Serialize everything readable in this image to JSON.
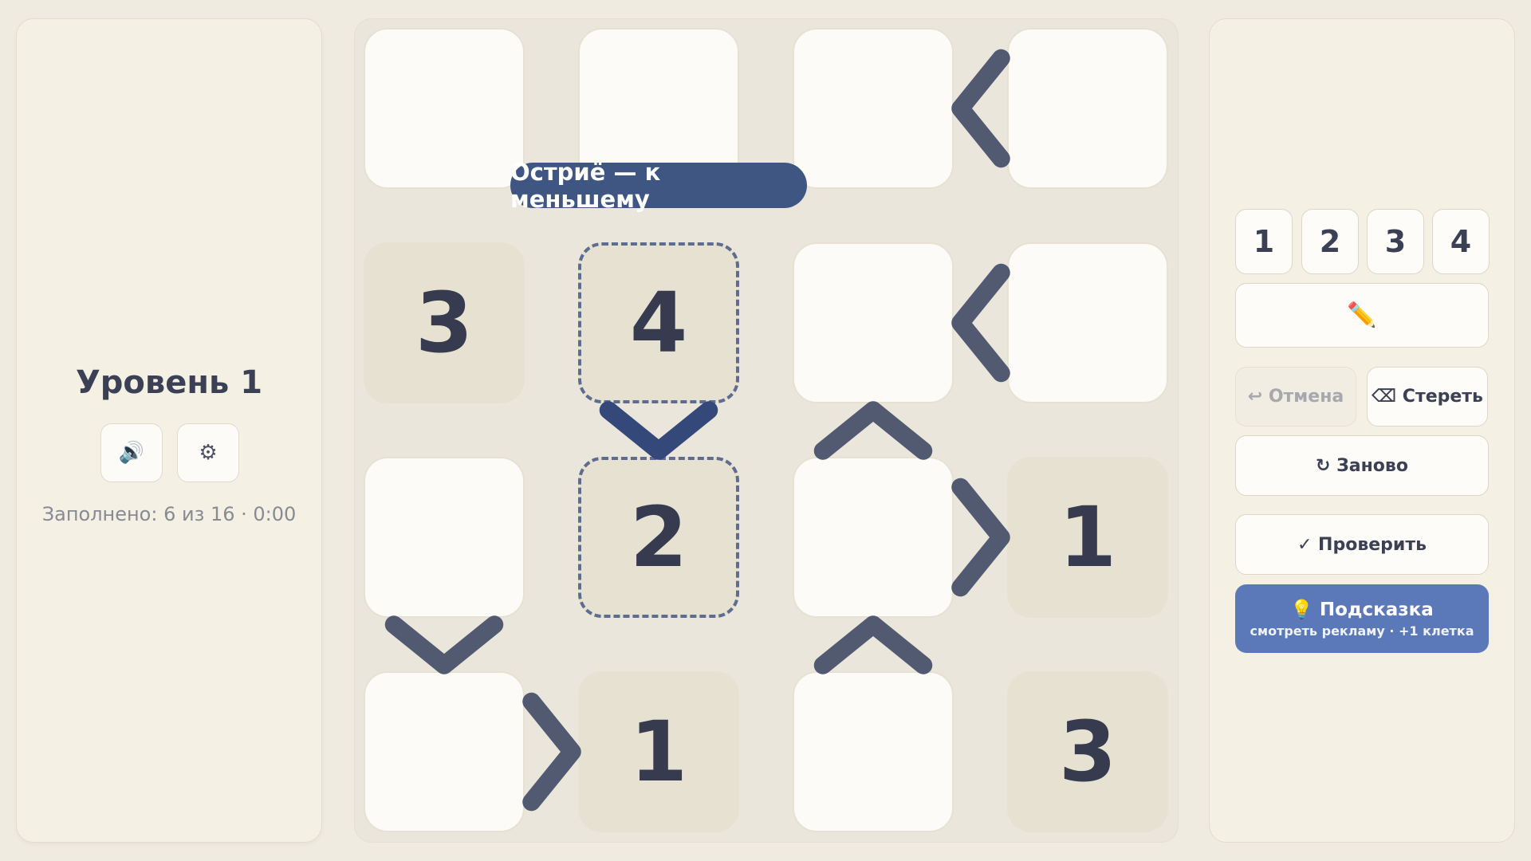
{
  "sidebar": {
    "level_title": "Уровень 1",
    "sound_icon": "🔊",
    "settings_icon": "⚙",
    "status": "Заполнено: 6 из 16 · 0:00"
  },
  "board": {
    "size": 4,
    "cells": [
      [
        {
          "value": "",
          "given": false
        },
        {
          "value": "",
          "given": false
        },
        {
          "value": "",
          "given": false
        },
        {
          "value": "",
          "given": false
        }
      ],
      [
        {
          "value": "3",
          "given": true
        },
        {
          "value": "4",
          "given": true,
          "selected": true
        },
        {
          "value": "",
          "given": false
        },
        {
          "value": "",
          "given": false
        }
      ],
      [
        {
          "value": "",
          "given": false
        },
        {
          "value": "2",
          "given": true,
          "selected": true
        },
        {
          "value": "",
          "given": false
        },
        {
          "value": "1",
          "given": true
        }
      ],
      [
        {
          "value": "",
          "given": false
        },
        {
          "value": "1",
          "given": true
        },
        {
          "value": "",
          "given": false
        },
        {
          "value": "3",
          "given": true
        }
      ]
    ],
    "relations": [
      {
        "between": [
          [
            0,
            2
          ],
          [
            0,
            3
          ]
        ],
        "symbol": "<",
        "highlighted": false
      },
      {
        "between": [
          [
            1,
            2
          ],
          [
            1,
            3
          ]
        ],
        "symbol": "<",
        "highlighted": false
      },
      {
        "between": [
          [
            1,
            1
          ],
          [
            2,
            1
          ]
        ],
        "symbol": "v",
        "highlighted": true
      },
      {
        "between": [
          [
            1,
            2
          ],
          [
            2,
            2
          ]
        ],
        "symbol": "^",
        "highlighted": false
      },
      {
        "between": [
          [
            2,
            2
          ],
          [
            2,
            3
          ]
        ],
        "symbol": ">",
        "highlighted": false
      },
      {
        "between": [
          [
            2,
            0
          ],
          [
            3,
            0
          ]
        ],
        "symbol": "v",
        "highlighted": false
      },
      {
        "between": [
          [
            2,
            2
          ],
          [
            3,
            2
          ]
        ],
        "symbol": "^",
        "highlighted": false
      },
      {
        "between": [
          [
            3,
            0
          ],
          [
            3,
            1
          ]
        ],
        "symbol": ">",
        "highlighted": false
      }
    ],
    "tooltip": "Остриё — к меньшему"
  },
  "controls": {
    "digits": [
      "1",
      "2",
      "3",
      "4"
    ],
    "pencil_icon": "✏️",
    "undo_label": "↩ Отмена",
    "erase_label": "⌫ Стереть",
    "restart_label": "↻ Заново",
    "check_label": "✓ Проверить",
    "hint_label": "💡 Подсказка",
    "hint_sub": "смотреть рекламу · +1 клетка"
  },
  "colors": {
    "relation": "#525a72",
    "relation_highlight": "#34497a",
    "hint_button": "#5b78b9",
    "tooltip": "#3f5682"
  }
}
